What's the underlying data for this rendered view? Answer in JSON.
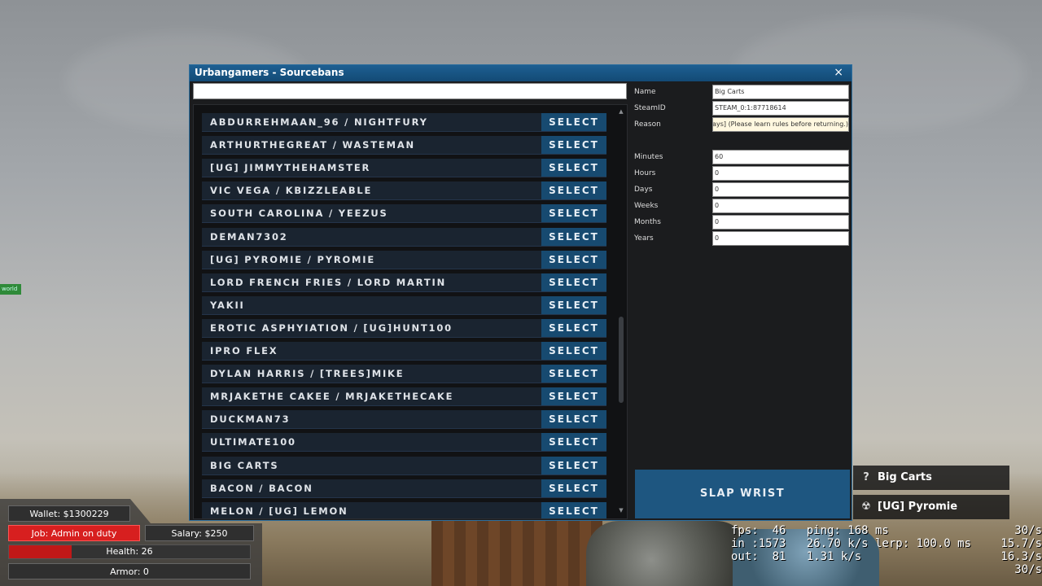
{
  "window": {
    "title": "Urbangamers - Sourcebans",
    "close_icon": "×"
  },
  "search": {
    "value": ""
  },
  "players": [
    "ABDURREHMAAN_96 / NIGHTFURY",
    "ARTHURTHEGREAT / WASTEMAN",
    "[UG] JIMMYTHEHAMSTER",
    "VIC VEGA / KBIZZLEABLE",
    "SOUTH CAROLINA / YEEZUS",
    "DEMAN7302",
    "[UG] PYROMIE / PYROMIE",
    "LORD FRENCH FRIES / LORD MARTIN",
    "YAKII",
    "EROTIC ASPHYIATION / [UG]HUNT100",
    "IPRO FLEX",
    "DYLAN HARRIS / [TREES]MIKE",
    "MRJAKETHE CAKEE / MRJAKETHECAKE",
    "DUCKMAN73",
    "ULTIMATE100",
    "BIG CARTS",
    "BACON / BACON",
    "MELON / [UG] LEMON"
  ],
  "select_label": "SELECT",
  "form": {
    "name_label": "Name",
    "name_value": "Big Carts",
    "steamid_label": "SteamID",
    "steamid_value": "STEAM_0:1:87718614",
    "reason_label": "Reason",
    "reason_value": "ays] (Please learn rules before returning.)",
    "minutes_label": "Minutes",
    "minutes_value": "60",
    "hours_label": "Hours",
    "hours_value": "0",
    "days_label": "Days",
    "days_value": "0",
    "weeks_label": "Weeks",
    "weeks_value": "0",
    "months_label": "Months",
    "months_value": "0",
    "years_label": "Years",
    "years_value": "0"
  },
  "slap_button": "SLAP WRIST",
  "world_tag": "world",
  "hud": {
    "wallet": "Wallet: $1300229",
    "job": "Job: Admin on duty",
    "salary": "Salary: $250",
    "health": "Health: 26",
    "health_fraction": 0.26,
    "armor": "Armor: 0"
  },
  "scoreboard_cards": [
    {
      "icon": "?",
      "name": "Big Carts"
    },
    {
      "icon": "☢",
      "name": "[UG] Pyromie"
    }
  ],
  "netgraph": {
    "line1": "fps:  46   ping: 168 ms",
    "line2": "in :1573   26.70 k/s lerp: 100.0 ms",
    "line3": "out:  81   1.31 k/s",
    "right1": "30/s",
    "right2": "15.7/s",
    "right3": "16.3/s",
    "right4": "30/s"
  },
  "colors": {
    "accent": "#1e5680",
    "titlebar": "#1d5f92",
    "job": "#d71f1f"
  }
}
